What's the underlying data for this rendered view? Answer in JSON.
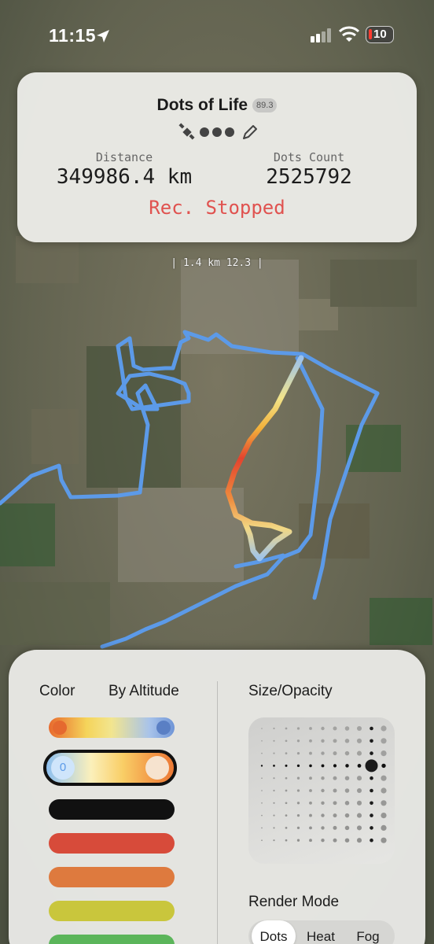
{
  "status_bar": {
    "time": "11:15",
    "battery": "10"
  },
  "header": {
    "title": "Dots of Life",
    "version": "89.3",
    "icons": [
      "satellite-icon",
      "dot-icon",
      "dot-icon",
      "dot-icon",
      "pencil-icon"
    ]
  },
  "stats": {
    "distance_label": "Distance",
    "distance_value": "349986.4 km",
    "dots_label": "Dots Count",
    "dots_value": "2525792",
    "status": "Rec. Stopped"
  },
  "map": {
    "scale_label": "| 1.4 km 12.3 |"
  },
  "colors": {
    "track": "#5c9ae8",
    "rec_stopped": "#e0524f",
    "swatches": [
      "#111111",
      "#d74b3a",
      "#de7a3e",
      "#c9c63c",
      "#5bb55a"
    ]
  },
  "panel": {
    "color_label": "Color",
    "color_mode": "By Altitude",
    "size_opacity_label": "Size/Opacity",
    "render_mode_label": "Render Mode",
    "selected_altitude_min": "0",
    "render_modes": [
      "Dots",
      "Heat",
      "Fog"
    ],
    "active_render_mode": "Dots"
  }
}
